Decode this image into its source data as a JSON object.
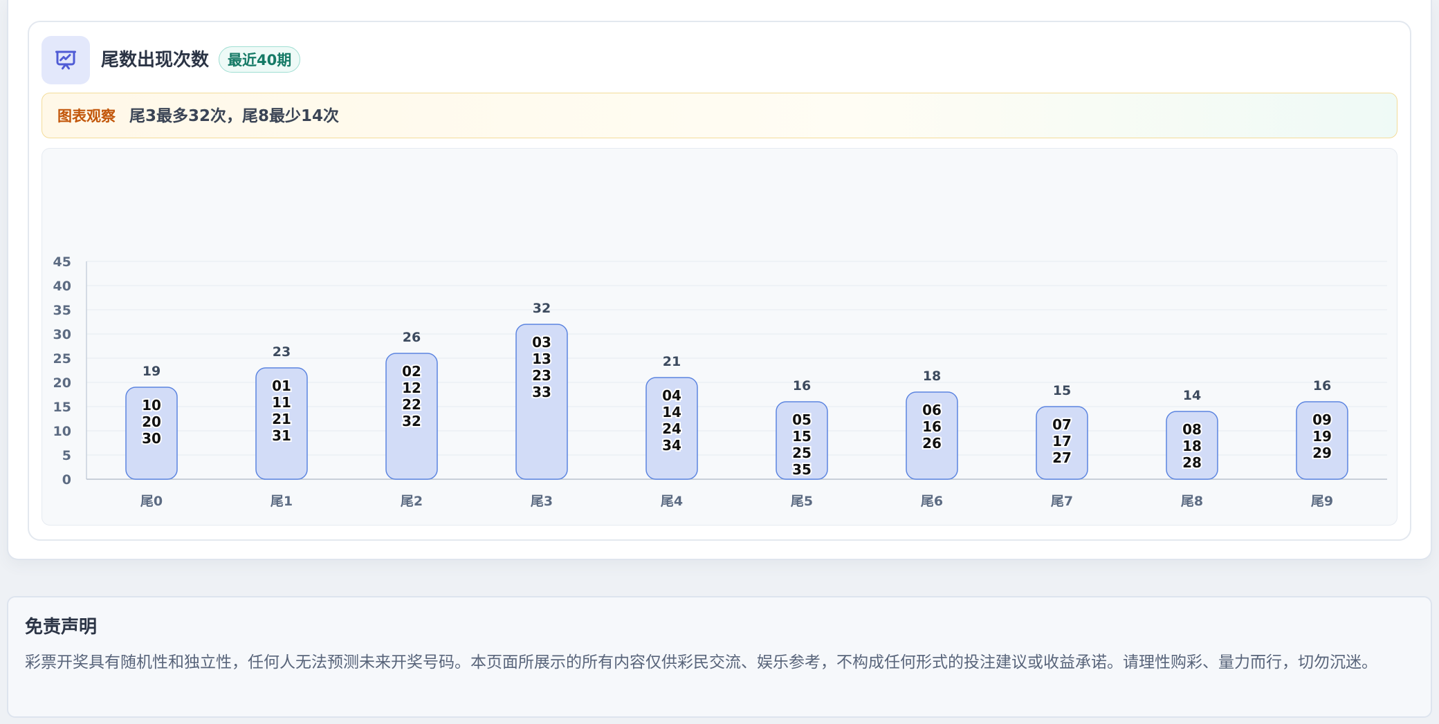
{
  "header": {
    "title": "尾数出现次数",
    "badge": "最近40期",
    "icon": "chart-presentation-icon"
  },
  "insight": {
    "tag": "图表观察",
    "text": "尾3最多32次，尾8最少14次"
  },
  "colors": {
    "bar_fill": "#d2dcf7",
    "bar_stroke": "#5b84e0",
    "axis_text": "#5c6b82",
    "value_text": "#3c4a5e",
    "tag_orange": "#c2560a",
    "badge_green": "#157a66"
  },
  "chart_data": {
    "type": "bar",
    "categories": [
      "尾0",
      "尾1",
      "尾2",
      "尾3",
      "尾4",
      "尾5",
      "尾6",
      "尾7",
      "尾8",
      "尾9"
    ],
    "values": [
      19,
      23,
      26,
      32,
      21,
      16,
      18,
      15,
      14,
      16
    ],
    "numbers": [
      [
        "10",
        "20",
        "30"
      ],
      [
        "01",
        "11",
        "21",
        "31"
      ],
      [
        "02",
        "12",
        "22",
        "32"
      ],
      [
        "03",
        "13",
        "23",
        "33"
      ],
      [
        "04",
        "14",
        "24",
        "34"
      ],
      [
        "05",
        "15",
        "25",
        "35"
      ],
      [
        "06",
        "16",
        "26"
      ],
      [
        "07",
        "17",
        "27"
      ],
      [
        "08",
        "18",
        "28"
      ],
      [
        "09",
        "19",
        "29"
      ]
    ],
    "ylim": [
      0,
      45
    ],
    "yticks": [
      "0",
      "5",
      "10",
      "15",
      "20",
      "25",
      "30",
      "35",
      "40",
      "45"
    ],
    "grid": true
  },
  "disclaimer": {
    "title": "免责声明",
    "text": "彩票开奖具有随机性和独立性，任何人无法预测未来开奖号码。本页面所展示的所有内容仅供彩民交流、娱乐参考，不构成任何形式的投注建议或收益承诺。请理性购彩、量力而行，切勿沉迷。"
  }
}
